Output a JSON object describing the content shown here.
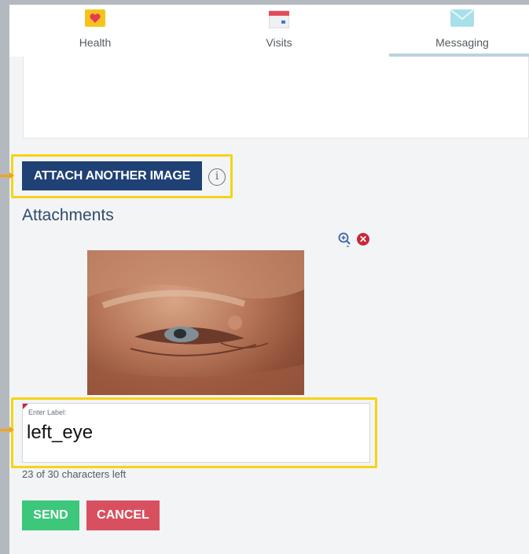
{
  "tabs": [
    {
      "label": "Health",
      "icon": "heart-icon",
      "color": "#f7c21c"
    },
    {
      "label": "Visits",
      "icon": "calendar-icon",
      "color": "#e44b5a"
    },
    {
      "label": "Messaging",
      "icon": "envelope-icon",
      "color": "#8fd6e4",
      "active": true
    }
  ],
  "attach": {
    "button_label": "ATTACH ANOTHER IMAGE",
    "info_glyph": "i"
  },
  "attachments": {
    "title": "Attachments",
    "image_description": "close-up photo of a left eye"
  },
  "label_field": {
    "caption": "Enter Label:",
    "value": "left_eye",
    "chars_left": "23 of 30 characters left"
  },
  "actions": {
    "send_label": "SEND",
    "cancel_label": "CANCEL"
  },
  "colors": {
    "highlight": "#f5d416",
    "primary": "#1f4175",
    "send": "#3cc77b",
    "cancel": "#d8505f"
  }
}
